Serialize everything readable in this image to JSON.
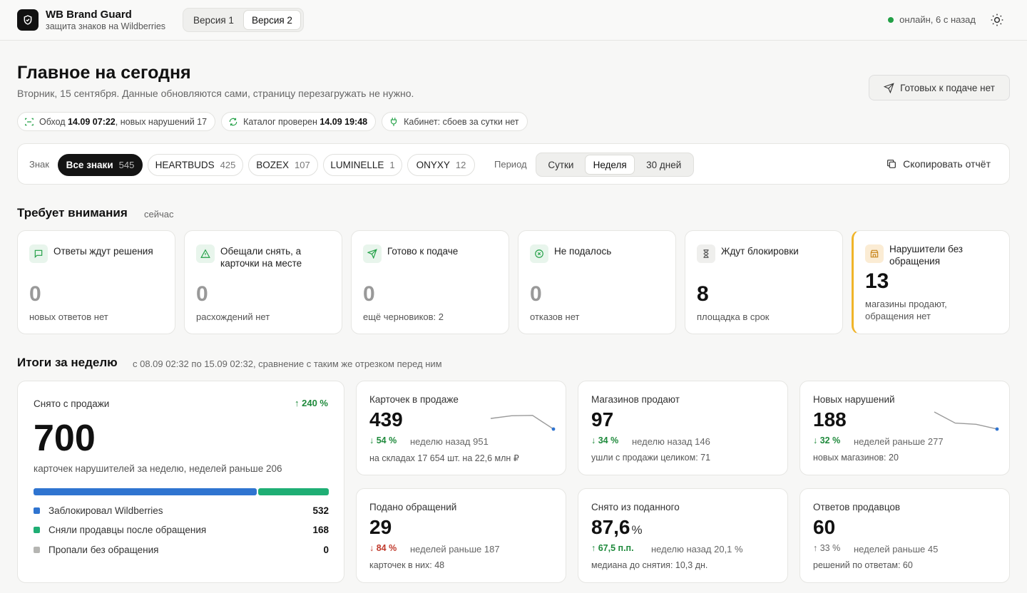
{
  "app": {
    "title": "WB Brand Guard",
    "subtitle": "защита знаков на Wildberries",
    "versions": [
      "Версия 1",
      "Версия 2"
    ],
    "active_version": "Версия 2",
    "status": "онлайн, 6 с назад"
  },
  "page": {
    "title": "Главное на сегодня",
    "subtitle": "Вторник, 15 сентября. Данные обновляются сами, страницу перезагружать не нужно.",
    "ready_button": "Готовых к подаче нет"
  },
  "status_chips": {
    "crawl_prefix": "Обход ",
    "crawl_time": "14.09 07:22",
    "crawl_suffix": ", новых нарушений 17",
    "catalog_prefix": "Каталог проверен ",
    "catalog_time": "14.09 19:48",
    "cabinet": "Кабинет: сбоев за сутки нет"
  },
  "filters": {
    "brand_label": "Знак",
    "brands": [
      {
        "name": "Все знаки",
        "count": "545"
      },
      {
        "name": "HEARTBUDS",
        "count": "425"
      },
      {
        "name": "BOZEX",
        "count": "107"
      },
      {
        "name": "LUMINELLE",
        "count": "1"
      },
      {
        "name": "ONYXY",
        "count": "12"
      }
    ],
    "period_label": "Период",
    "periods": [
      "Сутки",
      "Неделя",
      "30 дней"
    ],
    "active_period": "Неделя",
    "copy_report": "Скопировать отчёт"
  },
  "attention": {
    "title": "Требует внимания",
    "note": "сейчас",
    "cards": [
      {
        "title": "Ответы ждут решения",
        "value": "0",
        "note": "новых ответов нет",
        "icon": "chat-icon"
      },
      {
        "title": "Обещали снять, а карточки на месте",
        "value": "0",
        "note": "расхождений нет",
        "icon": "warning-icon"
      },
      {
        "title": "Готово к подаче",
        "value": "0",
        "note": "ещё черновиков: 2",
        "icon": "send-icon"
      },
      {
        "title": "Не подалось",
        "value": "0",
        "note": "отказов нет",
        "icon": "x-circle-icon"
      },
      {
        "title": "Ждут блокировки",
        "value": "8",
        "note": "площадка в срок",
        "icon": "hourglass-icon"
      },
      {
        "title": "Нарушители без обращения",
        "value": "13",
        "note": "магазины продают, обращения нет",
        "icon": "store-icon"
      }
    ]
  },
  "weekly": {
    "title": "Итоги за неделю",
    "note": "с 08.09 02:32 по 15.09 02:32, сравнение с таким же отрезком перед ним",
    "removed": {
      "label": "Снято с продажи",
      "delta": "↑ 240 %",
      "value": "700",
      "note": "карточек нарушителей за неделю, неделей раньше 206",
      "breakdown": [
        {
          "label": "Заблокировал Wildberries",
          "value": 532,
          "color": "#2f74d0"
        },
        {
          "label": "Сняли продавцы после обращения",
          "value": 168,
          "color": "#1fae74"
        },
        {
          "label": "Пропали без обращения",
          "value": 0,
          "color": "#b5b5b2"
        }
      ]
    },
    "kpis": [
      {
        "label": "Карточек в продаже",
        "value": "439",
        "unit": "",
        "delta": "↓ 54 %",
        "delta_color": "green",
        "prev": "неделю назад 951",
        "sub": "на складах 17 654 шт. на 22,6 млн ₽",
        "spark": [
          0.62,
          0.78,
          0.8,
          0.0
        ]
      },
      {
        "label": "Магазинов продают",
        "value": "97",
        "unit": "",
        "delta": "↓ 34 %",
        "delta_color": "green",
        "prev": "неделю назад 146",
        "sub": "ушли с продажи целиком: 71",
        "spark": null
      },
      {
        "label": "Новых нарушений",
        "value": "188",
        "unit": "",
        "delta": "↓ 32 %",
        "delta_color": "green",
        "prev": "неделей раньше 277",
        "sub": "новых магазинов: 20",
        "spark": [
          1.0,
          0.35,
          0.28,
          0.0
        ]
      },
      {
        "label": "Подано обращений",
        "value": "29",
        "unit": "",
        "delta": "↓ 84 %",
        "delta_color": "red",
        "prev": "неделей раньше 187",
        "sub": "карточек в них: 48",
        "spark": null
      },
      {
        "label": "Снято из поданного",
        "value": "87,6",
        "unit": "%",
        "delta": "↑ 67,5 п.п.",
        "delta_color": "green",
        "prev": "неделю назад 20,1 %",
        "sub": "медиана до снятия: 10,3 дн.",
        "spark": null
      },
      {
        "label": "Ответов продавцов",
        "value": "60",
        "unit": "",
        "delta": "↑ 33 %",
        "delta_color": "gray",
        "prev": "неделей раньше 45",
        "sub": "решений по ответам: 60",
        "spark": null
      }
    ]
  }
}
